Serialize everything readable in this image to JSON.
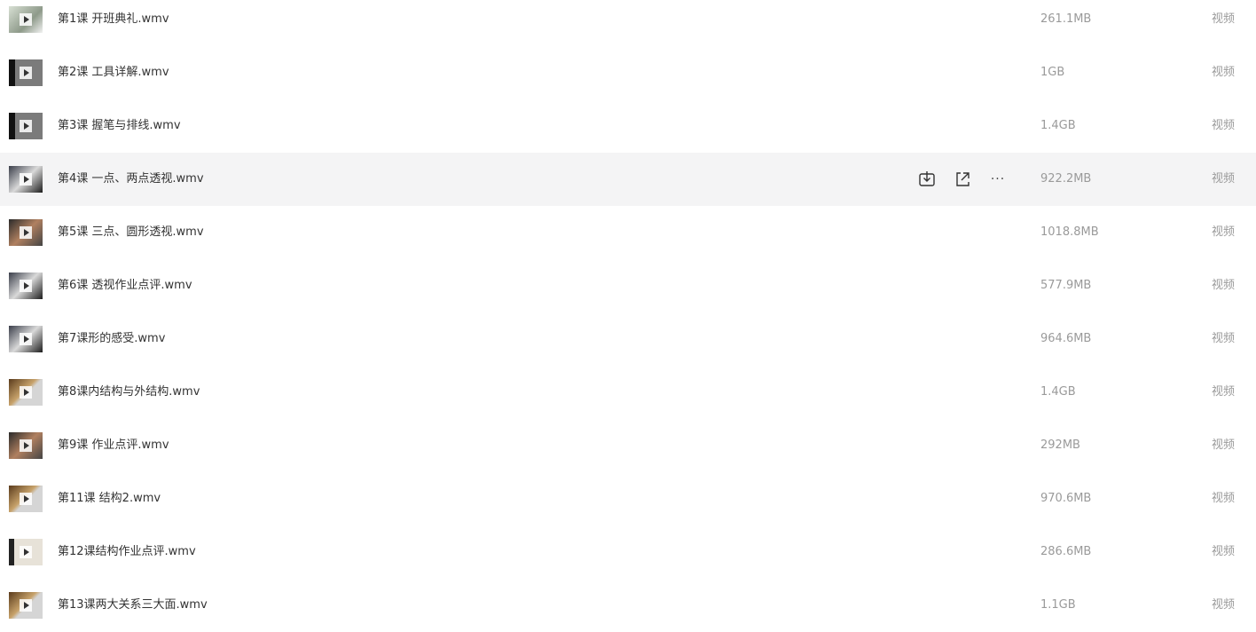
{
  "files": [
    {
      "name": "第1课 开班典礼.wmv",
      "size": "261.1MB",
      "type": "视频",
      "thumb": "light"
    },
    {
      "name": "第2课 工具详解.wmv",
      "size": "1GB",
      "type": "视频",
      "thumb": "dark"
    },
    {
      "name": "第3课 握笔与排线.wmv",
      "size": "1.4GB",
      "type": "视频",
      "thumb": "dark"
    },
    {
      "name": "第4课 一点、两点透视.wmv",
      "size": "922.2MB",
      "type": "视频",
      "thumb": "mix",
      "hover": true
    },
    {
      "name": "第5课 三点、圆形透视.wmv",
      "size": "1018.8MB",
      "type": "视频",
      "thumb": "warm"
    },
    {
      "name": "第6课 透视作业点评.wmv",
      "size": "577.9MB",
      "type": "视频",
      "thumb": "mix"
    },
    {
      "name": "第7课形的感受.wmv",
      "size": "964.6MB",
      "type": "视频",
      "thumb": "mix"
    },
    {
      "name": "第8课内结构与外结构.wmv",
      "size": "1.4GB",
      "type": "视频",
      "thumb": "food"
    },
    {
      "name": "第9课 作业点评.wmv",
      "size": "292MB",
      "type": "视频",
      "thumb": "warm"
    },
    {
      "name": "第11课 结构2.wmv",
      "size": "970.6MB",
      "type": "视频",
      "thumb": "food"
    },
    {
      "name": "第12课结构作业点评.wmv",
      "size": "286.6MB",
      "type": "视频",
      "thumb": "paper"
    },
    {
      "name": "第13课两大关系三大面.wmv",
      "size": "1.1GB",
      "type": "视频",
      "thumb": "food"
    }
  ],
  "hover_actions": {
    "download_icon": "download-icon",
    "share_icon": "share-icon",
    "more_icon": "more-icon",
    "more_glyph": "···"
  }
}
